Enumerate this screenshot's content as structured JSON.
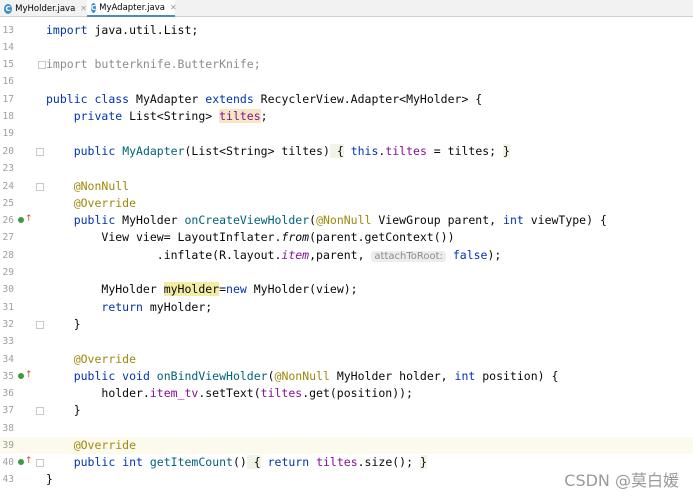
{
  "tabs": [
    {
      "label": "MyHolder.java",
      "icon": "java-class-icon",
      "active": false
    },
    {
      "label": "MyAdapter.java",
      "icon": "java-class-icon",
      "active": true
    }
  ],
  "lines": [
    {
      "num": "13"
    },
    {
      "num": "14"
    },
    {
      "num": "15"
    },
    {
      "num": "16"
    },
    {
      "num": "17"
    },
    {
      "num": "18"
    },
    {
      "num": "19"
    },
    {
      "num": "20"
    },
    {
      "num": "23"
    },
    {
      "num": "24"
    },
    {
      "num": "25"
    },
    {
      "num": "26"
    },
    {
      "num": "27"
    },
    {
      "num": "28"
    },
    {
      "num": "29"
    },
    {
      "num": "30"
    },
    {
      "num": "31"
    },
    {
      "num": "32"
    },
    {
      "num": "33"
    },
    {
      "num": "34"
    },
    {
      "num": "35"
    },
    {
      "num": "36"
    },
    {
      "num": "37"
    },
    {
      "num": "38"
    },
    {
      "num": "39"
    },
    {
      "num": "40"
    },
    {
      "num": "43"
    }
  ],
  "code": {
    "l13": {
      "kw": "import",
      "rest": " java.util.List;"
    },
    "l15": {
      "text": "import butterknife.ButterKnife;"
    },
    "l17": {
      "kw1": "public",
      "kw2": "class",
      "name": " MyAdapter ",
      "kw3": "extends",
      "rest": " RecyclerView.Adapter<MyHolder> {"
    },
    "l18": {
      "kw": "private",
      "type": " List<String> ",
      "field": "tiltes",
      "end": ";"
    },
    "l20": {
      "kw": "public",
      "fn": "MyAdapter",
      "args": "(List<String> tiltes)",
      "ob": " {",
      "kw2": " this",
      "dot": ".",
      "field": "tiltes",
      "rest": " = tiltes; ",
      "cb": "}"
    },
    "l24": {
      "ann": "@NonNull"
    },
    "l25": {
      "ann": "@Override"
    },
    "l26": {
      "kw": "public",
      "type": " MyHolder ",
      "fn": "onCreateViewHolder",
      "p1": "(",
      "ann": "@NonNull",
      "p2": " ViewGroup parent, ",
      "kw2": "int",
      "p3": " viewType) {"
    },
    "l27": {
      "a": "View view= LayoutInflater.",
      "m": "from",
      "b": "(parent.getContext())"
    },
    "l28": {
      "a": ".inflate(R.layout.",
      "m": "item",
      "b": ",parent, ",
      "hint": "attachToRoot:",
      "kw": " false",
      "c": ");"
    },
    "l30": {
      "a": "MyHolder ",
      "var": "myHolder",
      "b": "=",
      "kw": "new",
      "c": " MyHolder(view);"
    },
    "l31": {
      "kw": "return",
      "rest": " myHolder;"
    },
    "l32": {
      "text": "}"
    },
    "l34": {
      "ann": "@Override"
    },
    "l35": {
      "kw": "public",
      "kw2": " void",
      "fn": " onBindViewHolder",
      "p1": "(",
      "ann": "@NonNull",
      "p2": " MyHolder holder, ",
      "kw3": "int",
      "p3": " position) {"
    },
    "l36": {
      "a": "holder.",
      "f": "item_tv",
      "b": ".setText(",
      "f2": "tiltes",
      "c": ".get(position));"
    },
    "l37": {
      "text": "}"
    },
    "l39": {
      "ann": "@Override"
    },
    "l40": {
      "kw": "public",
      "kw2": " int",
      "fn": " getItemCount",
      "p": "()",
      "ob": " {",
      "kw3": " return",
      "f": " tiltes",
      "rest": ".size(); ",
      "cb": "}"
    },
    "l43": {
      "text": "}"
    }
  },
  "watermark": "CSDN @莫白媛"
}
